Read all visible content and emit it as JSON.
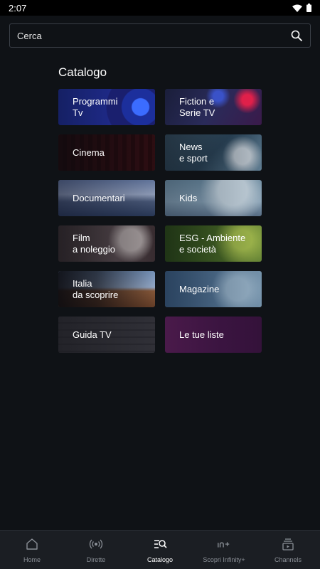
{
  "status_bar": {
    "time": "2:07"
  },
  "search": {
    "placeholder": "Cerca"
  },
  "page_title": "Catalogo",
  "tiles": [
    {
      "label": "Programmi\nTv"
    },
    {
      "label": "Fiction e\nSerie TV"
    },
    {
      "label": "Cinema"
    },
    {
      "label": "News\ne sport"
    },
    {
      "label": "Documentari"
    },
    {
      "label": "Kids"
    },
    {
      "label": "Film\na noleggio"
    },
    {
      "label": "ESG - Ambiente\ne società"
    },
    {
      "label": "Italia\nda scoprire"
    },
    {
      "label": "Magazine"
    },
    {
      "label": "Guida TV"
    },
    {
      "label": "Le tue liste"
    }
  ],
  "bottom_nav": [
    {
      "label": "Home",
      "icon": "home-icon"
    },
    {
      "label": "Dirette",
      "icon": "broadcast-icon"
    },
    {
      "label": "Catalogo",
      "icon": "catalog-search-icon",
      "active": true
    },
    {
      "label": "Scopri Infinity+",
      "icon": "infinity-plus-icon"
    },
    {
      "label": "Channels",
      "icon": "channels-icon"
    }
  ]
}
